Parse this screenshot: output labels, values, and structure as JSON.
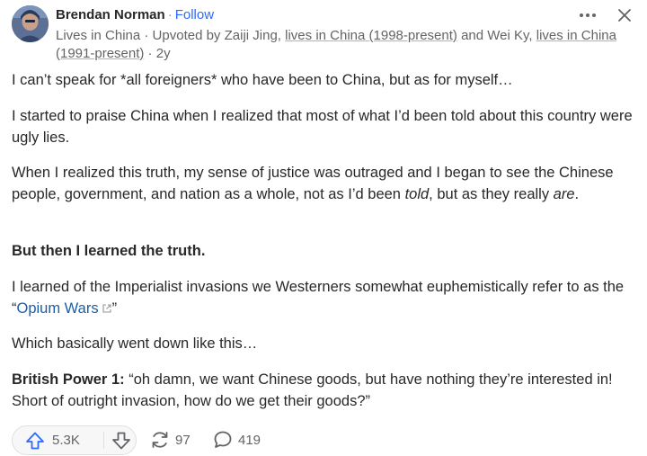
{
  "author": {
    "name": "Brendan Norman",
    "separator": "·",
    "follow_label": "Follow",
    "credential_prefix": "Lives in China · Upvoted by ",
    "upvoter1": "Zaiji Jing",
    "upvoter1_cred": "lives in China (1998-present)",
    "and_text": " and ",
    "upvoter2": "Wei Ky",
    "upvoter2_cred": "lives in China (1991-present)",
    "age": " · 2y",
    "avatar_icon": "avatar-photo"
  },
  "post": {
    "p1": "I can’t speak for *all foreigners* who have been to China, but as for myself…",
    "p2": "I started to praise China when I realized that most of what I’d been told about this country were ugly lies.",
    "p3_a": "When I realized this truth, my sense of justice was outraged and I began to see the Chinese people, government, and nation as a whole, not as I’d been ",
    "p3_told": "told",
    "p3_b": ", but as they really ",
    "p3_are": "are",
    "p3_c": ".",
    "p4": "But then I learned the truth.",
    "p5_a": "I learned of the Imperialist invasions we Westerners somewhat euphemistically refer to as the “",
    "p5_link": "Opium Wars",
    "p5_b": "”",
    "p6": "Which basically went down like this…",
    "p7_label": "British Power 1:",
    "p7_text": " “oh damn, we want Chinese goods, but have nothing they’re interested in! Short of outright invasion, how do we get their goods?”"
  },
  "actions": {
    "upvote_count": "5.3K",
    "share_count": "97",
    "comment_count": "419"
  },
  "colors": {
    "link": "#195faa",
    "follow": "#2e69ff",
    "icon": "#2e69ff"
  }
}
